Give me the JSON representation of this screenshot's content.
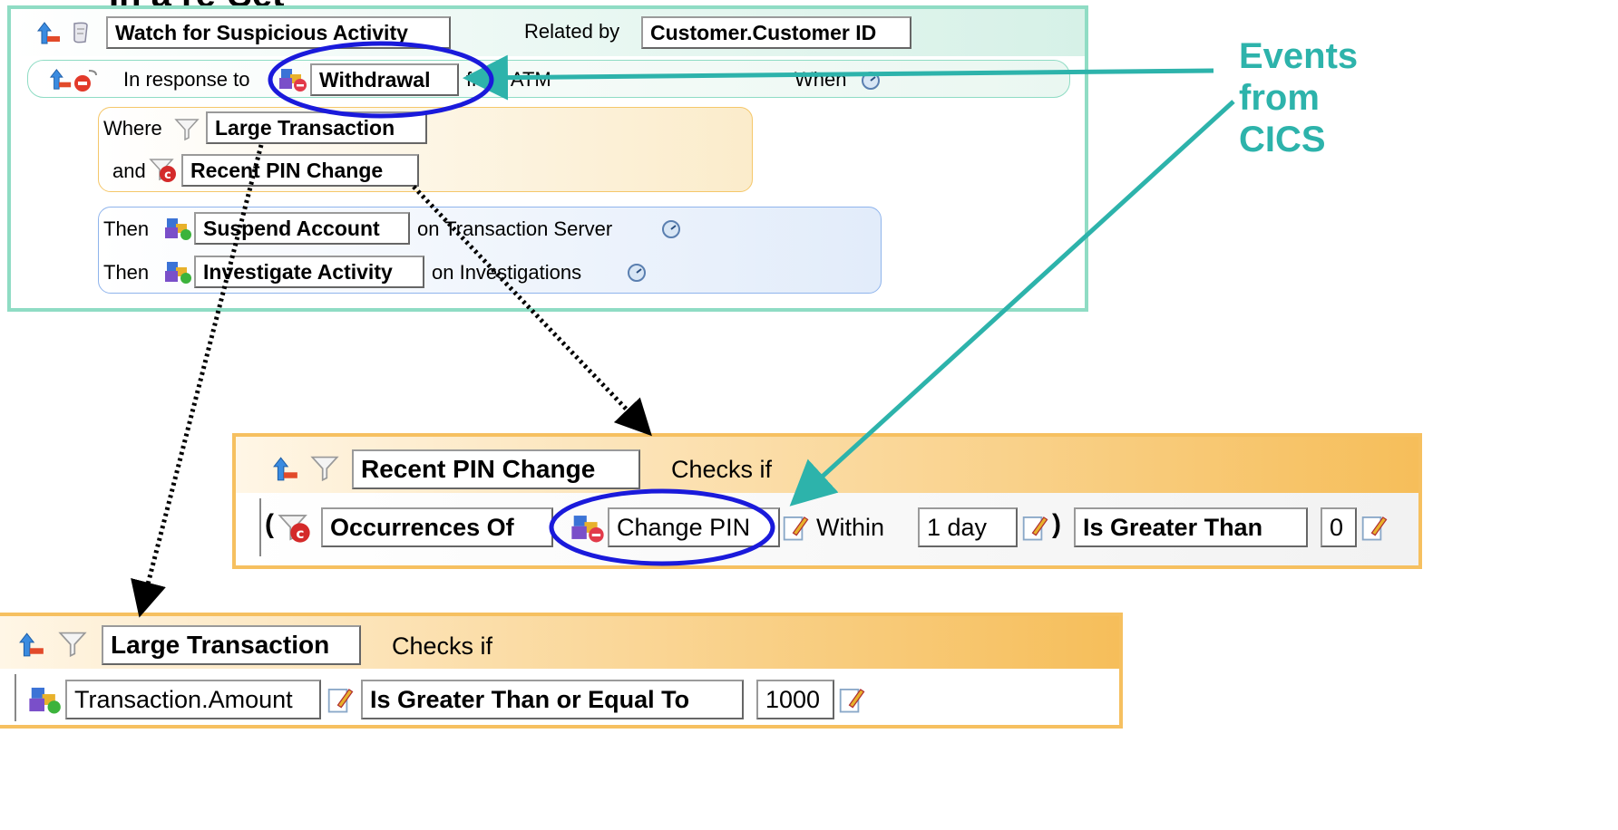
{
  "cut_title": "In a re-Set",
  "rule": {
    "title": "Watch for Suspicious Activity",
    "related_by_label": "Related by",
    "related_by_value": "Customer.Customer ID",
    "in_response_to_label": "In response to",
    "event": "Withdrawal",
    "from_label": "from ATM",
    "when_label": "When",
    "where_label": "Where",
    "filter1": "Large Transaction",
    "and_label": "and",
    "filter2": "Recent PIN Change",
    "then_label": "Then",
    "action1": "Suspend Account",
    "action1_target": "on Transaction Server",
    "action2": "Investigate Activity",
    "action2_target": "on Investigations"
  },
  "pin_filter": {
    "title": "Recent PIN Change",
    "checks_label": "Checks if",
    "open_paren": "(",
    "occurrences": "Occurrences Of",
    "event": "Change PIN",
    "within_label": "Within",
    "within_value": "1 day",
    "close_paren": ")",
    "operator": "Is Greater Than",
    "value": "0"
  },
  "large_filter": {
    "title": "Large Transaction",
    "checks_label": "Checks if",
    "field": "Transaction.Amount",
    "operator": "Is Greater Than or Equal To",
    "value": "1000"
  },
  "callout": {
    "line1": "Events",
    "line2": "from",
    "line3": "CICS",
    "color": "#2db3ab"
  },
  "colors": {
    "teal_border": "#8fdcc4",
    "highlight_ellipse": "#1a1adb",
    "filter_header_left": "#fff6e6",
    "filter_header_right": "#f6be5a"
  }
}
